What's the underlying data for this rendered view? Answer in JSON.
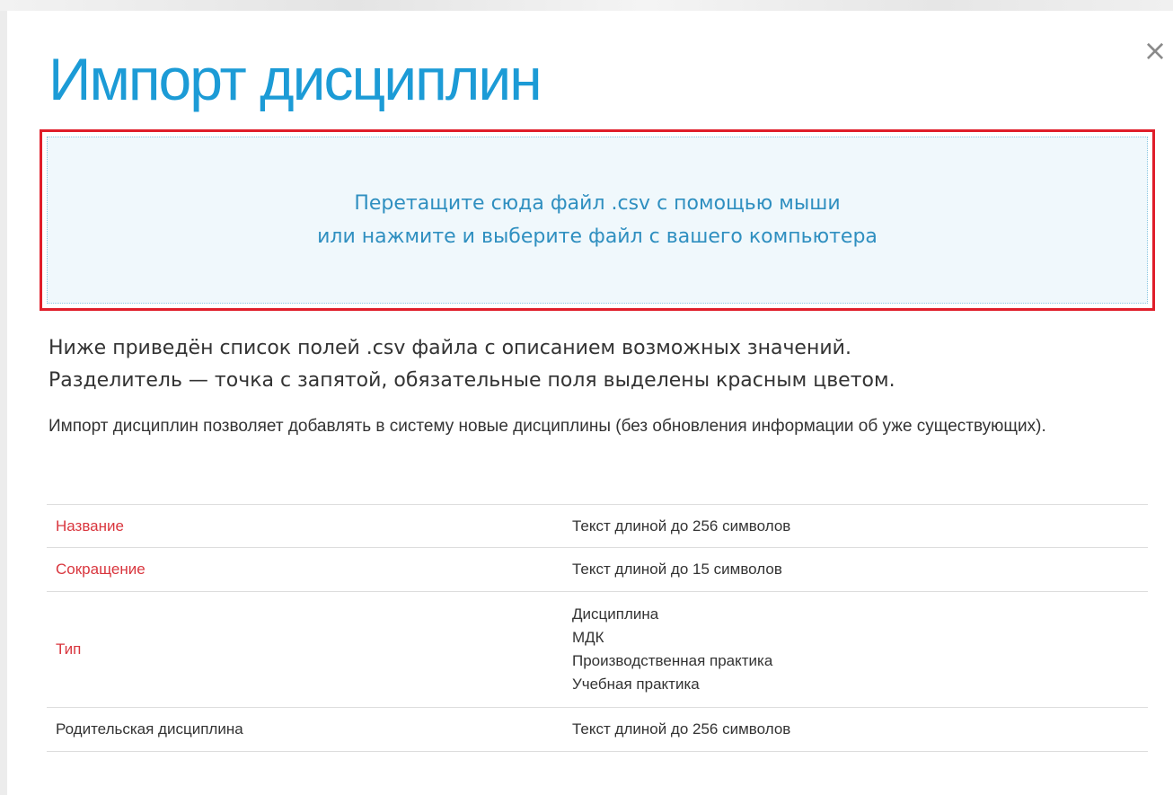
{
  "modal": {
    "close_symbol": "×",
    "title": "Импорт дисциплин"
  },
  "dropzone": {
    "line1": "Перетащите сюда файл .csv с помощью мыши",
    "line2": "или нажмите и выберите файл с вашего компьютера"
  },
  "intro": {
    "line1": "Ниже приведён список полей .csv файла с описанием возможных значений.",
    "line2": "Разделитель — точка с запятой, обязательные поля выделены красным цветом."
  },
  "note": "Импорт дисциплин позволяет добавлять в систему новые дисциплины (без обновления информации об уже существующих).",
  "fields": [
    {
      "name": "Название",
      "required": true,
      "description": "Текст длиной до 256 символов"
    },
    {
      "name": "Сокращение",
      "required": true,
      "description": "Текст длиной до 15 символов"
    },
    {
      "name": "Тип",
      "required": true,
      "options": [
        "Дисциплина",
        "МДК",
        "Производственная практика",
        "Учебная практика"
      ]
    },
    {
      "name": "Родительская дисциплина",
      "required": false,
      "description": "Текст длиной до 256 символов"
    }
  ],
  "colors": {
    "accent": "#1c9bd6",
    "required": "#d9363e",
    "highlight_border": "#e01e2a"
  }
}
